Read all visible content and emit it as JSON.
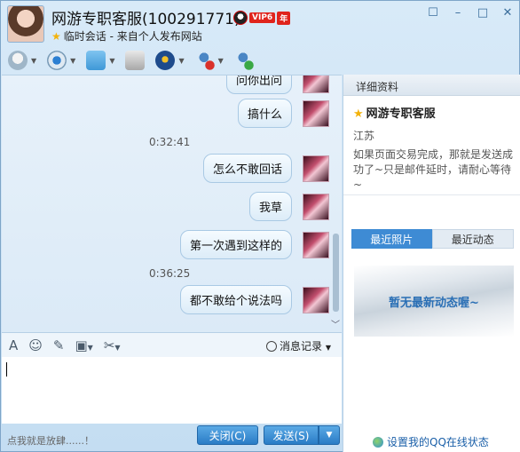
{
  "header": {
    "title": "网游专职客服(100291771)",
    "vip_label": "VIP6",
    "vip_year": "年",
    "subtitle": "临时会话 - 来自个人发布网站",
    "window_buttons": [
      "☐",
      "–",
      "□",
      "✕"
    ]
  },
  "toolbar": {
    "items": [
      "mic-icon",
      "camera-icon",
      "file-transfer-icon",
      "screenshot-icon",
      "app-icon",
      "remove-user-icon",
      "add-user-icon"
    ]
  },
  "chat": {
    "top_partial": "问你出问",
    "messages": [
      {
        "text": "搞什么"
      },
      {
        "time": "0:32:41"
      },
      {
        "text": "怎么不敢回话"
      },
      {
        "text": "我草"
      },
      {
        "text": "第一次遇到这样的"
      },
      {
        "time": "0:36:25"
      },
      {
        "text": "都不敢给个说法吗"
      }
    ],
    "m1": "搞什么",
    "t1": "0:32:41",
    "m2": "怎么不敢回话",
    "m3": "我草",
    "m4": "第一次遇到这样的",
    "t2": "0:36:25",
    "m5": "都不敢给个说法吗"
  },
  "input_toolbar": {
    "font_icon": "A",
    "emoji_icon": "☺",
    "history_label": "消息记录"
  },
  "footer": {
    "left_text": "点我就是放肆......！",
    "close_label": "关闭(C)",
    "send_label": "发送(S)",
    "send_dropdown": "▼"
  },
  "panel": {
    "header": "详细资料",
    "name": "网游专职客服",
    "location": "江苏",
    "description": "如果页面交易完成，那就是发送成功了~只是邮件延时，请耐心等待~",
    "tab_photos": "最近照片",
    "tab_activity": "最近动态",
    "empty_text": "暂无最新动态喔~",
    "qq_online": "设置我的QQ在线状态"
  },
  "colors": {
    "accent": "#3e8bd4",
    "button": "#2a7cc6",
    "vip_red": "#e0241c",
    "star": "#f3b20a"
  }
}
